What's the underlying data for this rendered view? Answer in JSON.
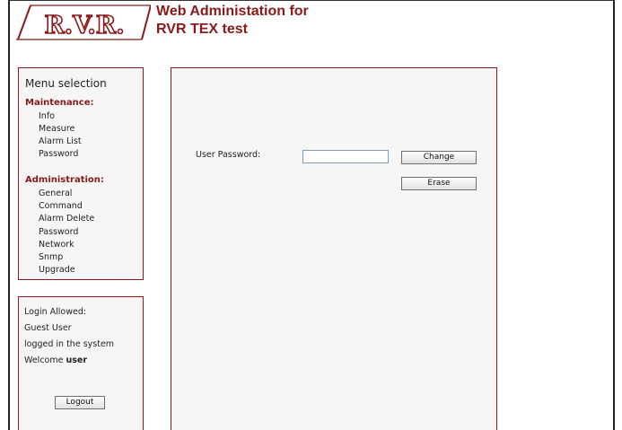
{
  "header": {
    "logo_text": "R.V.R.",
    "title_line1": "Web Administation for",
    "title_line2": "RVR TEX test"
  },
  "menu": {
    "title": "Menu selection",
    "maintenance_label": "Maintenance:",
    "maintenance_items": [
      "Info",
      "Measure",
      "Alarm List",
      "Password"
    ],
    "administration_label": "Administration:",
    "administration_items": [
      "General",
      "Command",
      "Alarm Delete",
      "Password",
      "Network",
      "Snmp",
      "Upgrade"
    ]
  },
  "login": {
    "line1": "Login Allowed:",
    "line2": "Guest User",
    "line3": "logged in the system",
    "welcome_prefix": "Welcome ",
    "username": "user",
    "logout_label": "Logout"
  },
  "main": {
    "password_label": "User Password:",
    "password_value": "",
    "change_label": "Change",
    "erase_label": "Erase"
  },
  "colors": {
    "brand": "#8a1a1a",
    "panel_bg": "#f6f6f6"
  }
}
